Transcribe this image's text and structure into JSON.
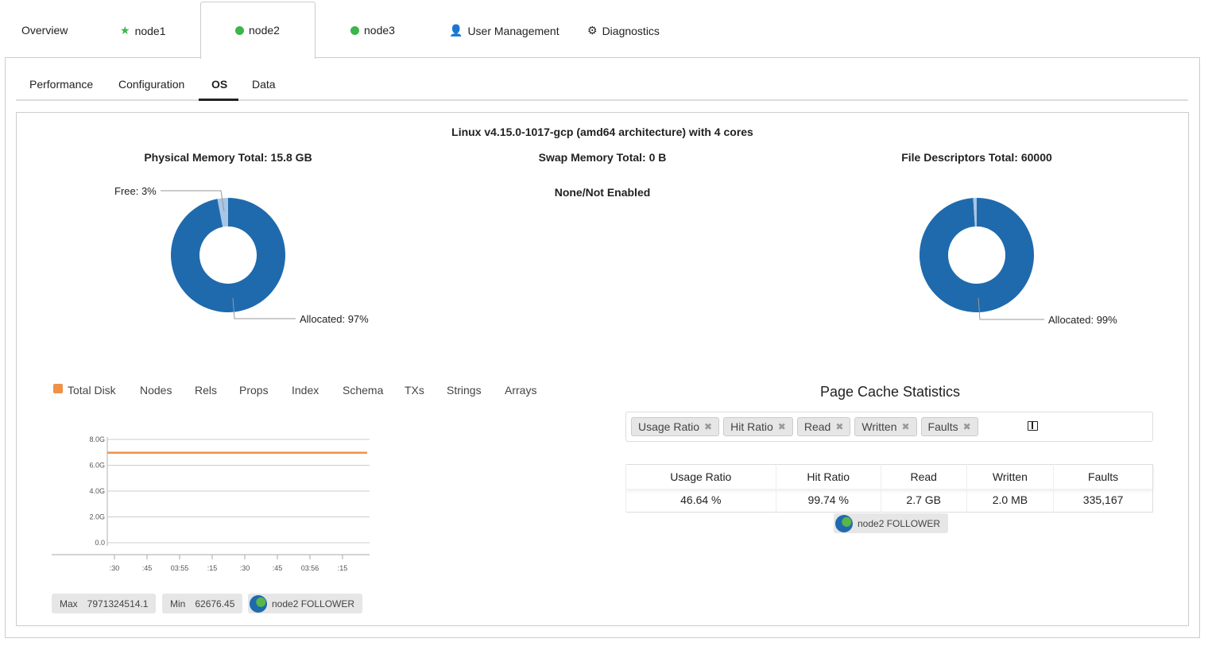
{
  "top_tabs": [
    {
      "label": "Overview",
      "icon": ""
    },
    {
      "label": "node1",
      "icon": "star-icon"
    },
    {
      "label": "node2",
      "icon": "status-dot-icon"
    },
    {
      "label": "node3",
      "icon": "status-dot-icon"
    },
    {
      "label": "User Management",
      "icon": "user-icon"
    },
    {
      "label": "Diagnostics",
      "icon": "gears-icon"
    }
  ],
  "active_top_tab": "node2",
  "sub_tabs": [
    "Performance",
    "Configuration",
    "OS",
    "Data"
  ],
  "active_sub_tab": "OS",
  "os": {
    "header": "Linux v4.15.0-1017-gcp (amd64 architecture) with 4 cores",
    "physical": {
      "title": "Physical Memory Total: 15.8 GB",
      "free_label": "Free: 3%",
      "allocated_label": "Allocated: 97%",
      "free_pct": 3,
      "allocated_pct": 97
    },
    "swap": {
      "title": "Swap Memory Total: 0 B",
      "status": "None/Not Enabled"
    },
    "fd": {
      "title": "File Descriptors Total: 60000",
      "allocated_label": "Allocated: 99%",
      "free_pct": 1,
      "allocated_pct": 99
    }
  },
  "colors": {
    "allocated": "#1f6aad",
    "free": "#a8c6e6",
    "line": "#f0914a",
    "status": "#3cb54a"
  },
  "disk": {
    "tabs": [
      "Total Disk",
      "Nodes",
      "Rels",
      "Props",
      "Index",
      "Schema",
      "TXs",
      "Strings",
      "Arrays"
    ],
    "active_tab": "Total Disk",
    "max_label": "Max",
    "max_value": "7971324514.1",
    "min_label": "Min",
    "min_value": "62676.45",
    "node_badge": "node2 FOLLOWER"
  },
  "chart_data": {
    "type": "line",
    "ylim": [
      0,
      8000000000
    ],
    "yticks": [
      "0.0",
      "2.0G",
      "4.0G",
      "6.0G",
      "8.0G"
    ],
    "xticks": [
      ":30",
      ":45",
      "03:55",
      ":15",
      ":30",
      ":45",
      "03:56",
      ":15"
    ],
    "grid": true,
    "series": [
      {
        "name": "Total Disk",
        "values": [
          6970000000,
          6970000000,
          6970000000,
          6970000000,
          6970000000,
          6970000000,
          6970000000,
          6970000000,
          6970000000
        ]
      }
    ]
  },
  "page_cache": {
    "title": "Page Cache Statistics",
    "tags": [
      "Usage Ratio",
      "Hit Ratio",
      "Read",
      "Written",
      "Faults"
    ],
    "columns": [
      "Usage Ratio",
      "Hit Ratio",
      "Read",
      "Written",
      "Faults"
    ],
    "row": [
      "46.64 %",
      "99.74 %",
      "2.7 GB",
      "2.0 MB",
      "335,167"
    ],
    "node_badge": "node2 FOLLOWER"
  }
}
